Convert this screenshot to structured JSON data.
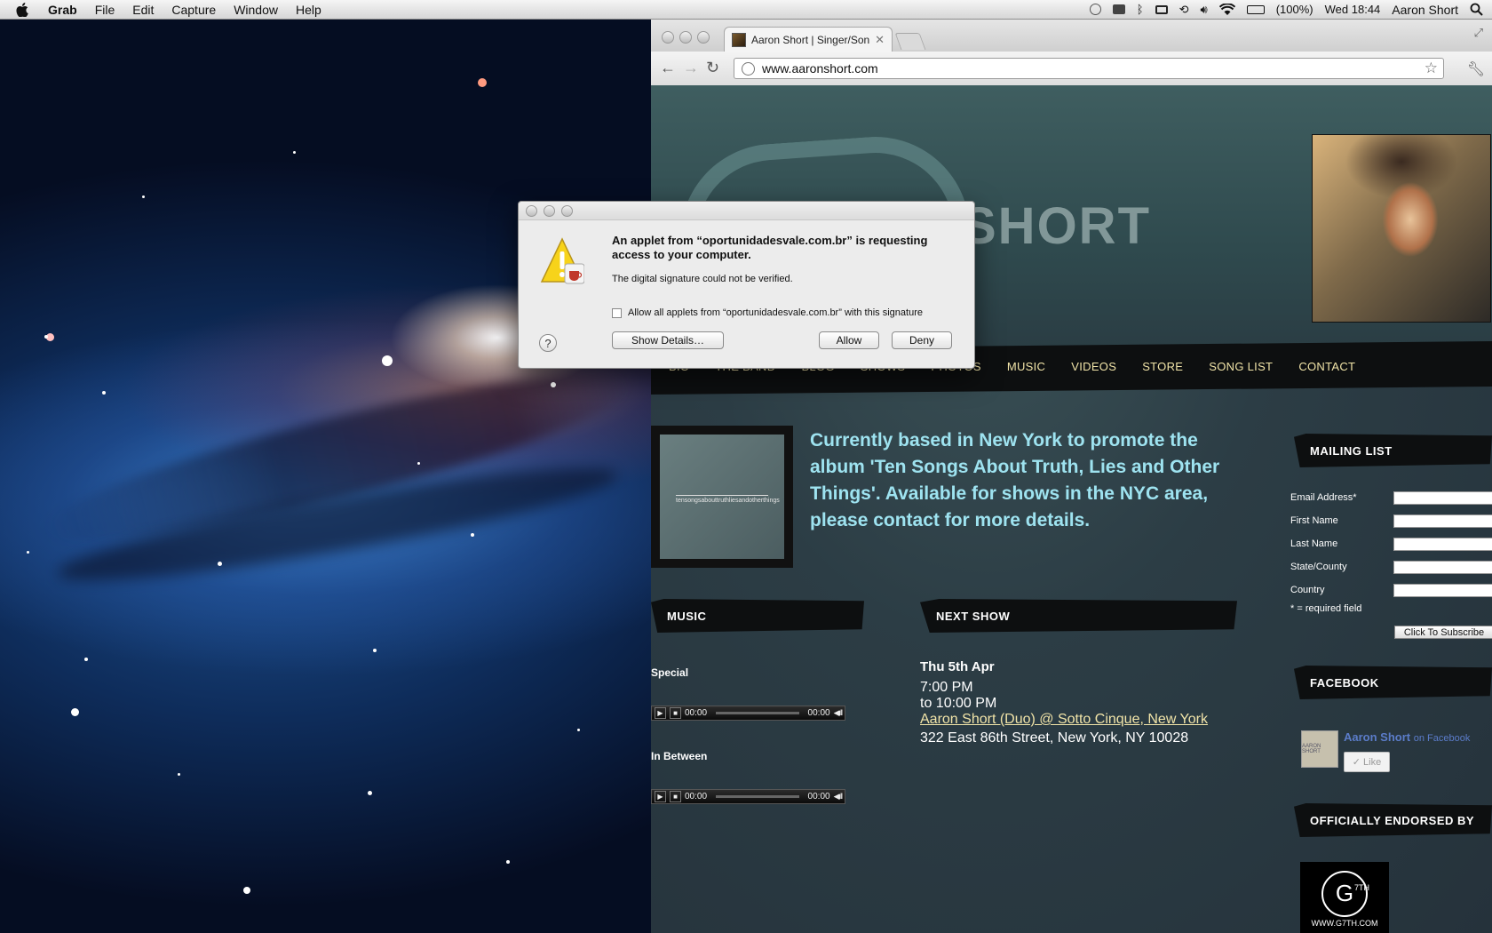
{
  "menubar": {
    "app": "Grab",
    "menus": [
      "File",
      "Edit",
      "Capture",
      "Window",
      "Help"
    ],
    "battery": "(100%)",
    "clock": "Wed 18:44",
    "user": "Aaron Short"
  },
  "browser": {
    "tab_title": "Aaron Short | Singer/Songwr",
    "url": "www.aaronshort.com"
  },
  "site": {
    "logo_text": "SHORT",
    "nav": [
      "BIO",
      "THE BAND",
      "BLOG",
      "SHOWS",
      "PHOTOS",
      "MUSIC",
      "VIDEOS",
      "STORE",
      "SONG LIST",
      "CONTACT"
    ],
    "album_cover_text": "tensongsabouttruthliesandotherthings",
    "tagline": "Currently based in New York to promote the album 'Ten Songs About Truth, Lies and Other Things'. Available for shows in the NYC area, please contact for more details.",
    "music": {
      "heading": "MUSIC",
      "tracks": [
        {
          "title": "Special",
          "elapsed": "00:00",
          "duration": "00:00"
        },
        {
          "title": "In Between",
          "elapsed": "00:00",
          "duration": "00:00"
        }
      ]
    },
    "next_show": {
      "heading": "NEXT SHOW",
      "date": "Thu 5th Apr",
      "start": "7:00 PM",
      "end": "to 10:00 PM",
      "venue_link": "Aaron Short (Duo) @ Sotto Cinque, New York",
      "address": "322 East 86th Street, New York, NY 10028"
    },
    "mailing_list": {
      "heading": "MAILING LIST",
      "fields": [
        "Email Address*",
        "First Name",
        "Last Name",
        "State/County",
        "Country"
      ],
      "required_note": "* = required field",
      "subscribe_label": "Click To Subscribe"
    },
    "facebook": {
      "heading": "FACEBOOK",
      "thumb_text": "AARON SHORT",
      "page_name": "Aaron Short",
      "on_facebook": "on Facebook",
      "like_label": "✓ Like"
    },
    "endorsed": {
      "heading": "OFFICIALLY ENDORSED BY",
      "logo_mark": "G",
      "logo_sup": "7TH",
      "logo_url": "WWW.G7TH.COM"
    }
  },
  "dialog": {
    "heading": "An applet from “oportunidadesvale.com.br” is requesting access to your computer.",
    "subtext": "The digital signature could not be verified.",
    "checkbox_label": "Allow all applets from “oportunidadesvale.com.br” with this signature",
    "help_label": "?",
    "show_details_label": "Show Details…",
    "allow_label": "Allow",
    "deny_label": "Deny"
  },
  "colors": {
    "nav_text": "#f1e4a8",
    "tagline": "#9ee3f0",
    "site_bg": "#2c3d45",
    "facebook_link": "#5b7cc9"
  }
}
